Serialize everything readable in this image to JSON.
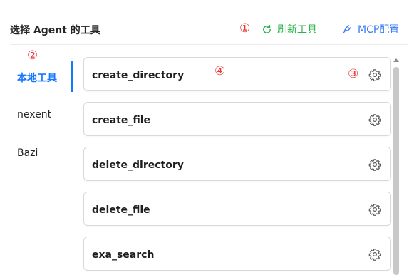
{
  "header": {
    "title": "选择 Agent 的工具",
    "refresh_label": "刷新工具",
    "mcp_label": "MCP配置"
  },
  "annotations": {
    "a1": "①",
    "a2": "②",
    "a3": "③",
    "a4": "④"
  },
  "sidebar": {
    "items": [
      {
        "label": "本地工具",
        "active": true
      },
      {
        "label": "nexent",
        "active": false
      },
      {
        "label": "Bazi",
        "active": false
      }
    ]
  },
  "tools": [
    {
      "name": "create_directory"
    },
    {
      "name": "create_file"
    },
    {
      "name": "delete_directory"
    },
    {
      "name": "delete_file"
    },
    {
      "name": "exa_search"
    }
  ],
  "colors": {
    "accent_blue": "#1677ff",
    "refresh_green": "#2bb24c",
    "annotation_red": "#e53935"
  },
  "icons": {
    "refresh": "refresh-icon",
    "mcp": "plug-icon",
    "settings": "gear-icon"
  }
}
